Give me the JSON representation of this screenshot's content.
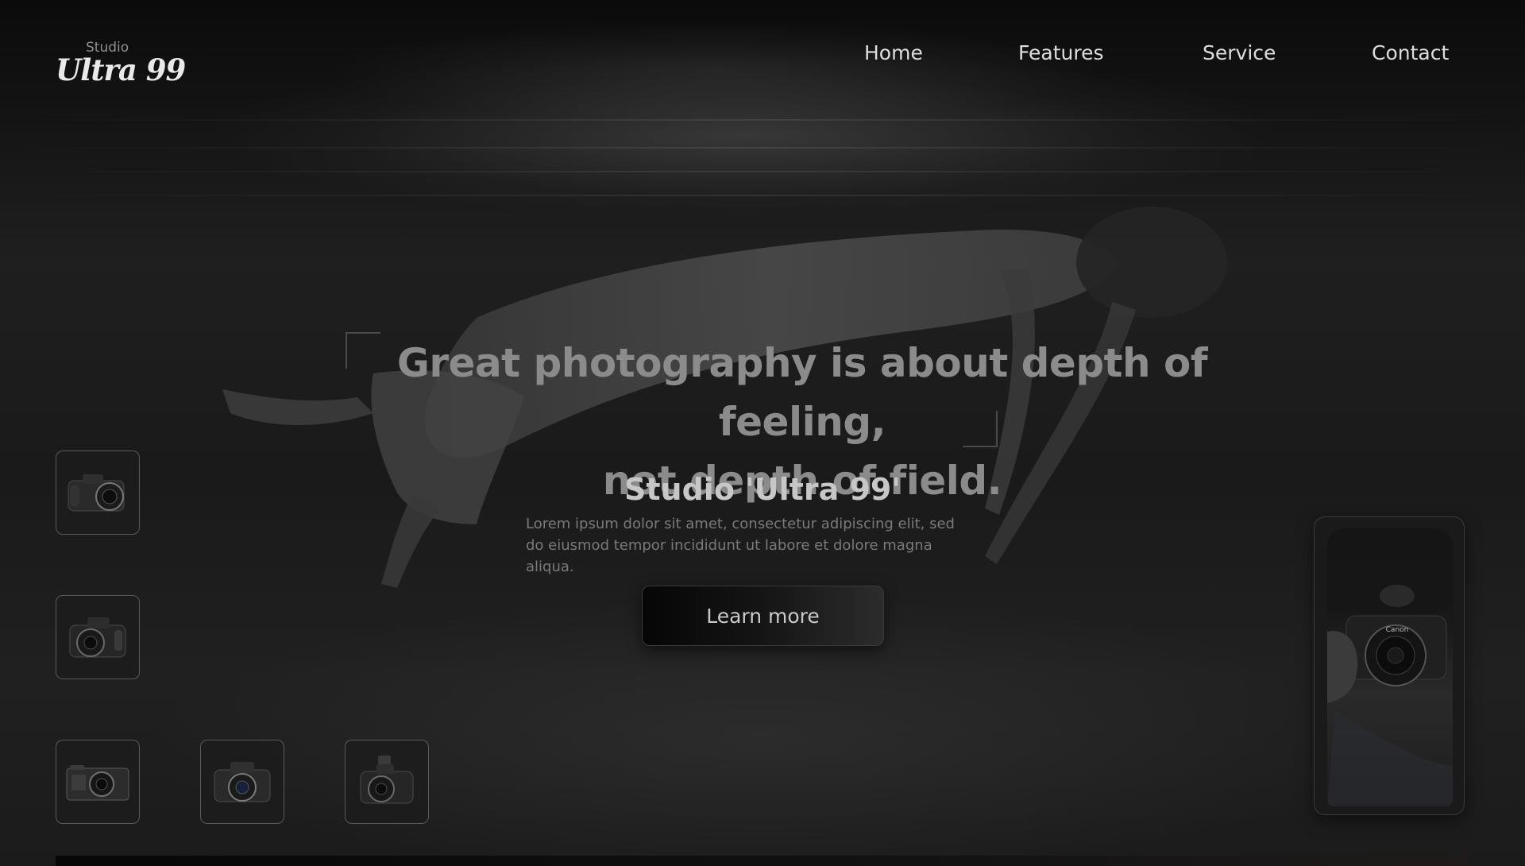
{
  "logo": {
    "small": "Studio",
    "main": "Ultra 99"
  },
  "nav": {
    "items": [
      {
        "label": "Home"
      },
      {
        "label": "Features"
      },
      {
        "label": "Service"
      },
      {
        "label": "Contact"
      }
    ]
  },
  "hero": {
    "quote_line1": "Great photography is about depth of feeling,",
    "quote_line2": "not depth of field.",
    "title": "Studio 'Ultra 99'",
    "description": "Lorem ipsum dolor sit amet, consectetur adipiscing elit, sed do eiusmod tempor incididunt ut labore et dolore magna aliqua.",
    "cta_label": "Learn more"
  },
  "thumbnails": [
    {
      "icon": "dslr-camera-icon"
    },
    {
      "icon": "dslr-camera-icon"
    },
    {
      "icon": "mirrorless-camera-icon"
    },
    {
      "icon": "canon-camera-icon"
    },
    {
      "icon": "flash-camera-icon"
    }
  ],
  "phone_card": {
    "brand_text": "Canon"
  },
  "colors": {
    "background": "#0d0d0d",
    "text_primary": "#dedede",
    "text_muted": "#7a7a7a",
    "quote": "#8b8b8b"
  }
}
